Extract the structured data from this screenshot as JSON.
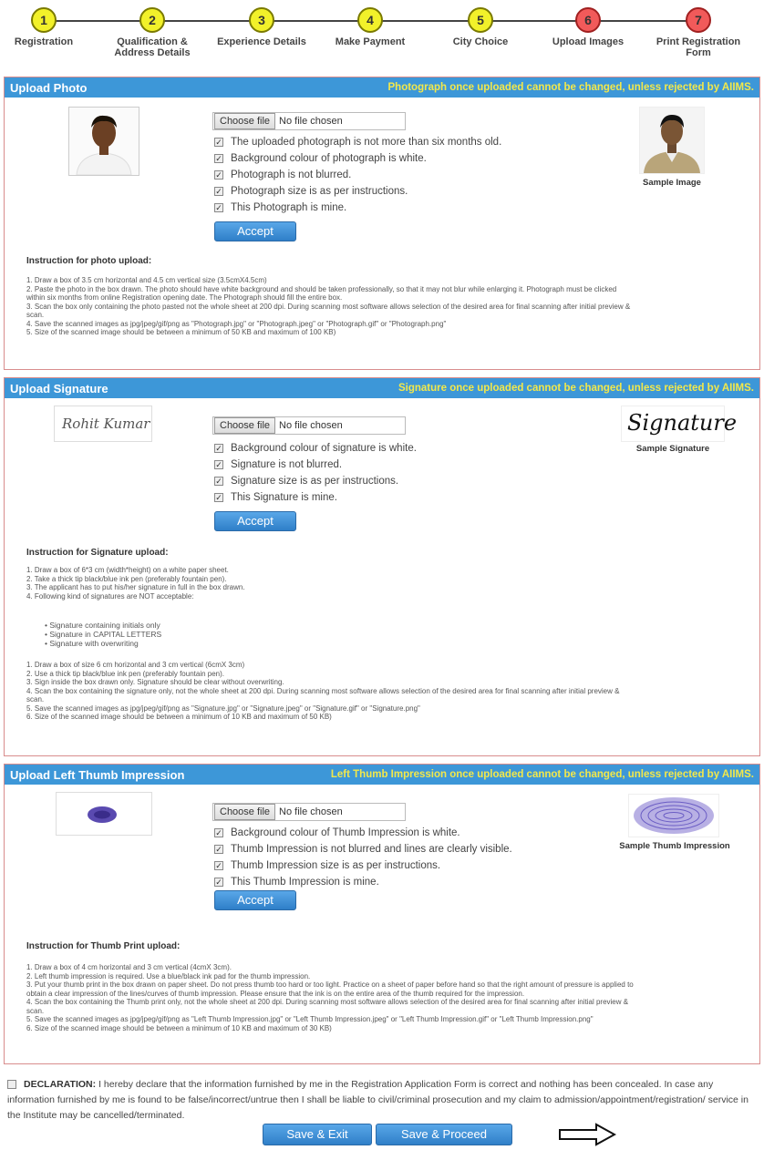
{
  "stepper": [
    {
      "num": "1",
      "label": "Registration",
      "status": "done"
    },
    {
      "num": "2",
      "label": "Qualification & Address Details",
      "status": "done"
    },
    {
      "num": "3",
      "label": "Experience Details",
      "status": "done"
    },
    {
      "num": "4",
      "label": "Make Payment",
      "status": "done"
    },
    {
      "num": "5",
      "label": "City Choice",
      "status": "done"
    },
    {
      "num": "6",
      "label": "Upload Images",
      "status": "current"
    },
    {
      "num": "7",
      "label": "Print Registration Form",
      "status": "pending"
    }
  ],
  "colors": {
    "header_blue": "#3d97d8",
    "note_yellow": "#f3e84a",
    "step_done": "#f2f12a",
    "step_pending": "#f15a5a"
  },
  "photo": {
    "title": "Upload Photo",
    "note": "Photograph once uploaded cannot be changed, unless rejected by AIIMS.",
    "choose_label": "Choose file",
    "file_status": "No file chosen",
    "checks": [
      "The uploaded photograph is not more than six months old.",
      "Background colour of photograph is white.",
      "Photograph is not blurred.",
      "Photograph size is as per instructions.",
      "This Photograph is mine."
    ],
    "accept": "Accept",
    "sample_caption": "Sample Image",
    "instr_title": "Instruction for photo upload:",
    "instructions": [
      "1. Draw a box of 3.5 cm horizontal and 4.5 cm vertical size (3.5cmX4.5cm)",
      "2. Paste the photo in the box drawn. The photo should have white background and should be taken professionally, so that it may not blur while enlarging it. Photograph must be clicked",
      "within six months from online Registration opening date. The Photograph should fill the entire box.",
      "3. Scan the box only containing the photo pasted not the whole sheet at 200 dpi. During scanning most software allows selection of the desired area for final scanning after initial preview &",
      "scan.",
      "4. Save the scanned images as jpg/jpeg/gif/png as \"Photograph.jpg\" or \"Photograph.jpeg\" or \"Photograph.gif\" or \"Photograph.png\"",
      "5. Size of the scanned image should be between a minimum of 50 KB and maximum of 100 KB)"
    ]
  },
  "signature": {
    "title": "Upload Signature",
    "note": "Signature once uploaded cannot be changed, unless rejected by AIIMS.",
    "choose_label": "Choose file",
    "file_status": "No file chosen",
    "uploaded_text": "Rohit Kumar",
    "sample_text": "Signature",
    "checks": [
      "Background colour of signature is white.",
      "Signature is not blurred.",
      "Signature size is as per instructions.",
      "This Signature is mine."
    ],
    "accept": "Accept",
    "sample_caption": "Sample Signature",
    "instr_title": "Instruction for Signature upload:",
    "instructions_a": [
      "1. Draw a box of 6*3 cm (width*height) on a white paper sheet.",
      "2. Take a thick tip black/blue ink pen (preferably fountain pen).",
      "3. The applicant has to put his/her signature in full in the box drawn.",
      "4. Following kind of signatures are NOT acceptable:"
    ],
    "bullets": [
      "Signature containing initials only",
      "Signature in CAPITAL LETTERS",
      "Signature with overwriting"
    ],
    "instructions_b": [
      "1. Draw a box of size 6 cm horizontal and 3 cm vertical (6cmX 3cm)",
      "2. Use a thick tip black/blue ink pen (preferably fountain pen).",
      "3. Sign inside the box drawn only. Signature should be clear without overwriting.",
      "4. Scan the box containing the signature only, not the whole sheet at 200 dpi. During scanning most software allows selection of the desired area for final scanning after initial preview &",
      "scan.",
      "5. Save the scanned images as jpg/jpeg/gif/png as \"Signature.jpg\" or \"Signature.jpeg\" or \"Signature.gif\" or \"Signature.png\"",
      "6. Size of the scanned image should be between a minimum of 10 KB and maximum of 50 KB)"
    ]
  },
  "thumb": {
    "title": "Upload Left Thumb Impression",
    "note": "Left Thumb Impression once uploaded cannot be changed, unless rejected by AIIMS.",
    "choose_label": "Choose file",
    "file_status": "No file chosen",
    "checks": [
      "Background colour of Thumb Impression is white.",
      "Thumb Impression is not blurred and lines are clearly visible.",
      "Thumb Impression size is as per instructions.",
      "This Thumb Impression is mine."
    ],
    "accept": "Accept",
    "sample_caption": "Sample Thumb Impression",
    "instr_title": "Instruction for Thumb Print upload:",
    "instructions": [
      "1. Draw a box of 4 cm horizontal and 3 cm vertical (4cmX 3cm).",
      "2. Left thumb impression is required. Use a blue/black ink pad for the thumb impression.",
      "3. Put your thumb print in the box drawn on paper sheet. Do not press thumb too hard or too light. Practice on a sheet of paper before hand so that the right amount of pressure is applied to",
      "obtain a clear impression of the lines/curves of thumb impression. Please ensure that the ink is on the entire area of the thumb required for the impression.",
      "4. Scan the box containing the Thumb print only, not the whole sheet at 200 dpi. During scanning most software allows selection of the desired area for final scanning after initial preview &",
      "scan.",
      "5. Save the scanned images as jpg/jpeg/gif/png as \"Left Thumb Impression.jpg\" or \"Left Thumb Impression.jpeg\" or \"Left Thumb Impression.gif\" or \"Left Thumb Impression.png\"",
      "6. Size of the scanned image should be between a minimum of 10 KB and maximum of 30 KB)"
    ]
  },
  "declaration": {
    "label": "DECLARATION:",
    "text": "I hereby declare that the information furnished by me in the Registration Application Form is correct and nothing has been concealed. In case any information furnished by me is found to be false/incorrect/untrue then I shall be liable to civil/criminal prosecution and my claim to admission/appointment/registration/ service in the Institute may be cancelled/terminated."
  },
  "buttons": {
    "save_exit": "Save & Exit",
    "save_proceed": "Save & Proceed"
  }
}
